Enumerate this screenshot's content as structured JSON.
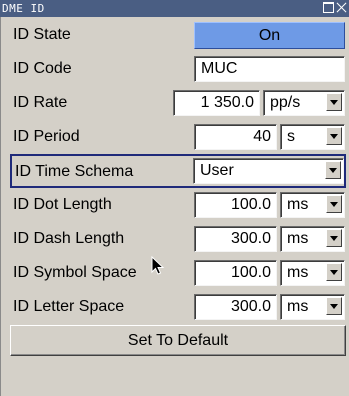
{
  "window": {
    "title": "DME ID"
  },
  "rows": [
    {
      "label": "ID State",
      "value": "On"
    },
    {
      "label": "ID Code",
      "value": "MUC"
    },
    {
      "label": "ID Rate",
      "value": "1 350.0",
      "unit": "pp/s"
    },
    {
      "label": "ID Period",
      "value": "40",
      "unit": "s"
    },
    {
      "label": "ID Time Schema",
      "value": "User"
    },
    {
      "label": "ID Dot Length",
      "value": "100.0",
      "unit": "ms"
    },
    {
      "label": "ID Dash Length",
      "value": "300.0",
      "unit": "ms"
    },
    {
      "label": "ID Symbol Space",
      "value": "100.0",
      "unit": "ms"
    },
    {
      "label": "ID Letter Space",
      "value": "300.0",
      "unit": "ms"
    }
  ],
  "default_button": "Set To Default",
  "colors": {
    "title_bar": "#4a5e83",
    "state_on": "#6e9ae6",
    "focus_border": "#1f2a7a",
    "panel_bg": "#d4d0c8"
  },
  "icons": [
    "maximize-icon",
    "close-icon",
    "mouse-pointer-icon",
    "dropdown-arrow-icon"
  ]
}
